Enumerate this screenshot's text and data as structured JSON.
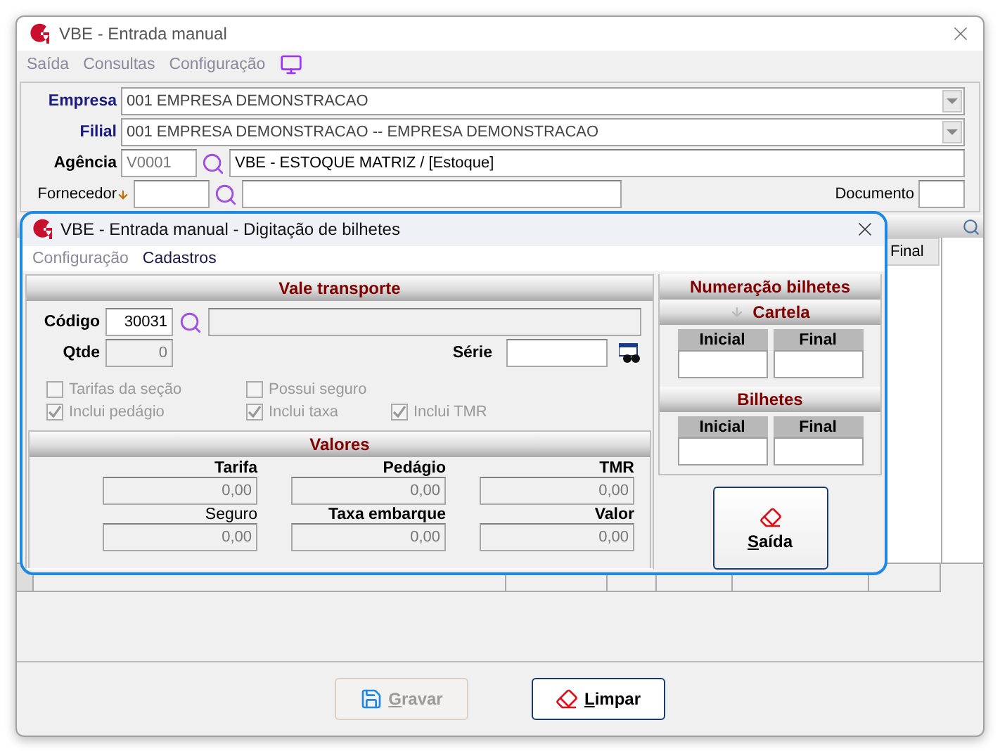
{
  "window": {
    "title": "VBE - Entrada manual"
  },
  "menu": [
    {
      "label": "Saída",
      "disabled": true
    },
    {
      "label": "Consultas",
      "disabled": true
    },
    {
      "label": "Configuração",
      "disabled": true
    }
  ],
  "form": {
    "empresa": {
      "label": "Empresa",
      "value": "001 EMPRESA DEMONSTRACAO"
    },
    "filial": {
      "label": "Filial",
      "value": "001 EMPRESA DEMONSTRACAO -- EMPRESA DEMONSTRACAO"
    },
    "agencia": {
      "label": "Agência",
      "code": "V0001",
      "name": "VBE - ESTOQUE MATRIZ / [Estoque]"
    },
    "fornecedor": {
      "label": "Fornecedor"
    },
    "documento": {
      "label": "Documento"
    }
  },
  "grid": {
    "columns": [
      {
        "label": "Final"
      }
    ]
  },
  "buttons": [
    {
      "label": "Gravar",
      "disabled": true,
      "kind": "save"
    },
    {
      "label": "Limpar",
      "disabled": false,
      "kind": "clear"
    }
  ],
  "dialog": {
    "title": "VBE - Entrada manual - Digitação de bilhetes",
    "menu": [
      {
        "label": "Configuração",
        "disabled": true
      },
      {
        "label": "Cadastros",
        "disabled": false
      }
    ],
    "vale_transporte": {
      "title": "Vale transporte",
      "codigo": {
        "label": "Código",
        "value": "30031"
      },
      "qtde": {
        "label": "Qtde",
        "value": "0"
      },
      "serie": {
        "label": "Série"
      },
      "options": [
        {
          "label": "Tarifas da seção",
          "checked": false,
          "disabled": true
        },
        {
          "label": "Possui seguro",
          "checked": false,
          "disabled": true
        },
        {
          "label": "Inclui pedágio",
          "checked": true,
          "disabled": true
        },
        {
          "label": "Inclui taxa",
          "checked": true,
          "disabled": true
        },
        {
          "label": "Inclui TMR",
          "checked": true,
          "disabled": true
        }
      ]
    },
    "valores": {
      "title": "Valores",
      "fields": [
        {
          "label": "Tarifa",
          "value": "0,00",
          "bold": true
        },
        {
          "label": "Pedágio",
          "value": "0,00",
          "bold": true
        },
        {
          "label": "TMR",
          "value": "0,00",
          "bold": true
        },
        {
          "label": "Seguro",
          "value": "0,00",
          "bold": false
        },
        {
          "label": "Taxa embarque",
          "value": "0,00",
          "bold": true
        },
        {
          "label": "Valor",
          "value": "0,00",
          "bold": true
        }
      ]
    },
    "numeracao": {
      "title": "Numeração bilhetes",
      "sections": [
        {
          "title": "Cartela",
          "kind": "sorted",
          "columns": [
            "Inicial",
            "Final"
          ]
        },
        {
          "title": "Bilhetes",
          "kind": "plain",
          "columns": [
            "Inicial",
            "Final"
          ]
        }
      ]
    },
    "exit_button": {
      "label": "Saída"
    }
  }
}
